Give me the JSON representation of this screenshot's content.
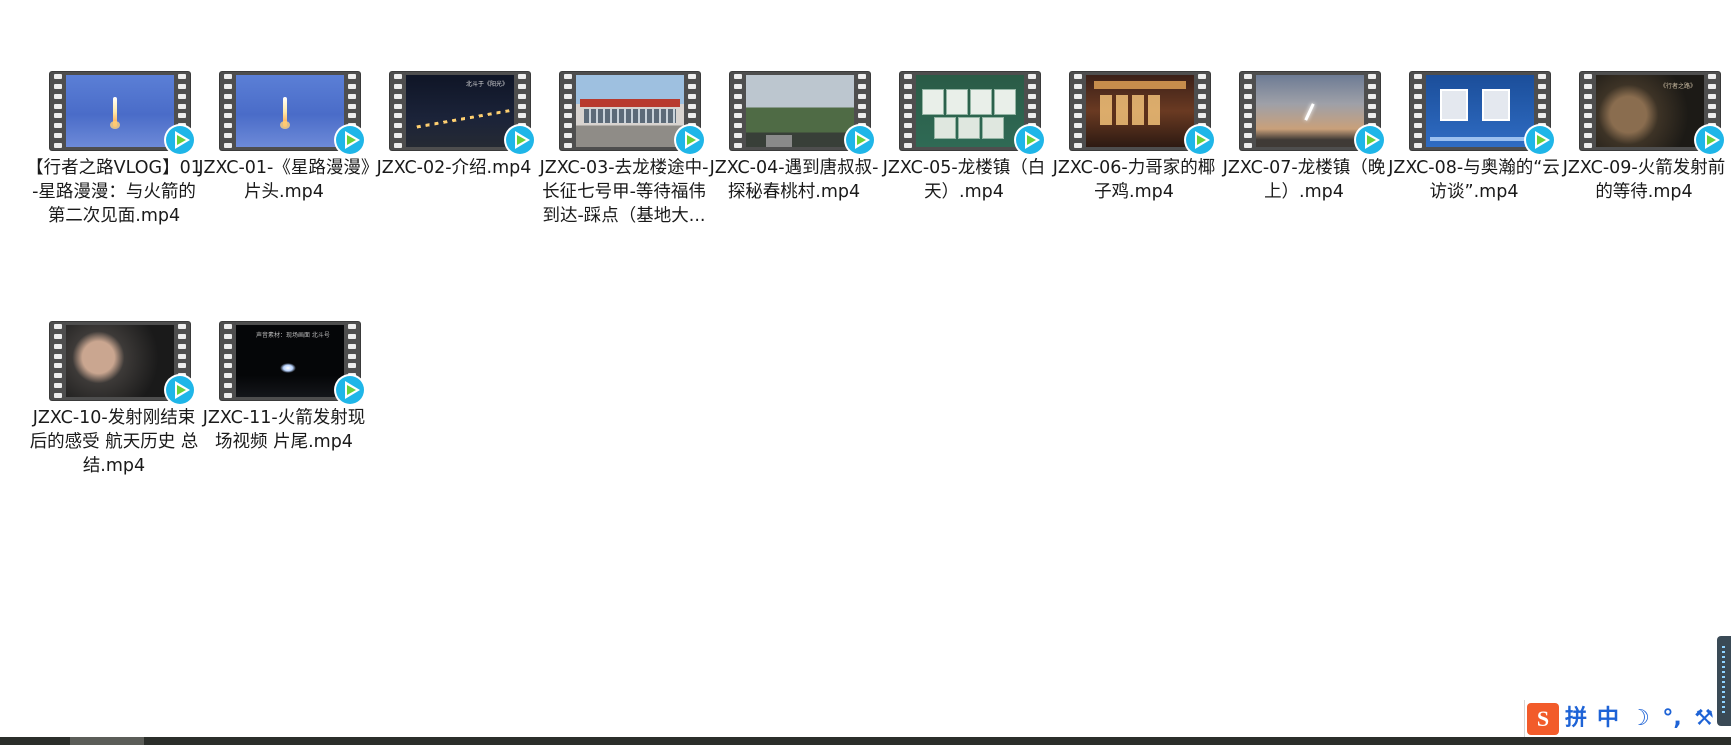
{
  "files": [
    {
      "name": "【行者之路VLOG】01-星路漫漫：与火箭的第二次见面.mp4",
      "thumb": "sky-rocket"
    },
    {
      "name": "JZXC-01-《星路漫漫》片头.mp4",
      "thumb": "sky-rocket"
    },
    {
      "name": "JZXC-02-介绍.mp4",
      "thumb": "night-bridge",
      "overlay": "北斗于《阳光》"
    },
    {
      "name": "JZXC-03-去龙楼途中-长征七号甲-等待福伟到达-踩点（基地大...",
      "thumb": "building"
    },
    {
      "name": "JZXC-04-遇到唐叔叔-探秘春桃村.mp4",
      "thumb": "forest"
    },
    {
      "name": "JZXC-05-龙楼镇（白天）.mp4",
      "thumb": "board"
    },
    {
      "name": "JZXC-06-力哥家的椰子鸡.mp4",
      "thumb": "shop"
    },
    {
      "name": "JZXC-07-龙楼镇（晚上）.mp4",
      "thumb": "dusk"
    },
    {
      "name": "JZXC-08-与奥瀚的“云访谈”.mp4",
      "thumb": "video-call"
    },
    {
      "name": "JZXC-09-火箭发射前的等待.mp4",
      "thumb": "portrait",
      "overlay": "《行者之路》"
    },
    {
      "name": "JZXC-10-发射刚结束后的感受 航天历史 总结.mp4",
      "thumb": "selfie"
    },
    {
      "name": "JZXC-11-火箭发射现场视频 片尾.mp4",
      "thumb": "night-launch",
      "overlay": "声音素材：现场画面 北斗号"
    }
  ],
  "ime": {
    "logo": "S",
    "buttons": [
      "拼",
      "中",
      "☽",
      "°,",
      "⚒"
    ]
  }
}
